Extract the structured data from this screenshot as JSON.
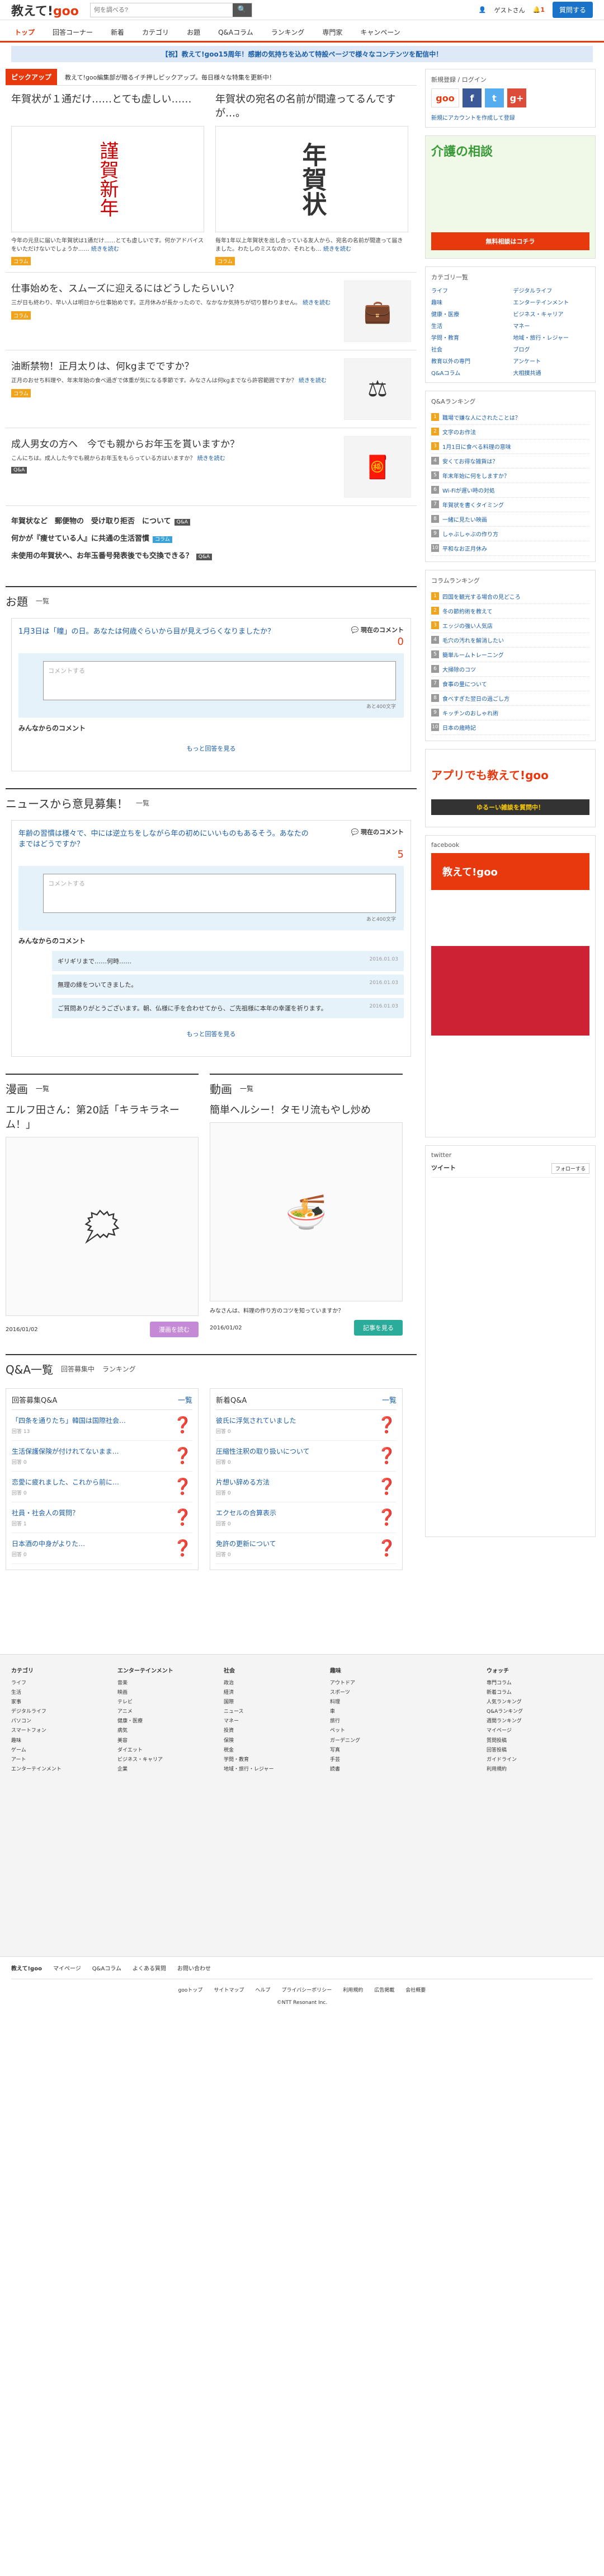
{
  "header": {
    "logo_main": "教えて!",
    "logo_sub": "goo",
    "search_placeholder": "何を調べる?",
    "guest": "ゲストさん",
    "notif": "1",
    "ask_button": "質問する"
  },
  "nav": [
    "トップ",
    "回答コーナー",
    "新着",
    "カテゴリ",
    "お題",
    "Q&Aコラム",
    "ランキング",
    "専門家",
    "キャンペーン"
  ],
  "banner": "【祝】教えて!goo15周年！感謝の気持ちを込めて特設ページで様々なコンテンツを配信中！",
  "pickup": {
    "label": "ピックアップ",
    "desc": "教えて!goo編集部が贈るイチ押しピックアップ。毎日様々な特集を更新中！",
    "cards": [
      {
        "title": "年賀状が１通だけ……とても虚しい……",
        "img": "謹賀新年",
        "desc": "今年の元旦に届いた年賀状は1通だけ……とても虚しいです。何かアドバイスをいただけないでしょうか……",
        "more": "続きを読む",
        "tag": "コラム"
      },
      {
        "title": "年賀状の宛名の名前が間違ってるんですが…。",
        "img": "年賀状",
        "desc": "毎年1年以上年賀状を出し合っている友人から、宛名の名前が間違って届きました。わたしのミスなのか、それとも…",
        "more": "続きを読む",
        "tag": "コラム"
      }
    ],
    "list": [
      {
        "title": "仕事始めを、スムーズに迎えるにはどうしたらいい？",
        "desc": "三が日も終わり、早い人は明日から仕事始めです。正月休みが長かったので、なかなか気持ちが切り替わりません。",
        "more": "続きを読む",
        "tag": "コラム",
        "icon": "💼"
      },
      {
        "title": "油断禁物！正月太りは、何kgまでですか？",
        "desc": "正月のおせち料理や、年末年始の食べ過ぎで体重が気になる季節です。みなさんは何kgまでなら許容範囲ですか？",
        "more": "続きを読む",
        "tag": "コラム",
        "icon": "⚖"
      },
      {
        "title": "成人男女の方へ　今でも親からお年玉を貰いますか？",
        "desc": "こんにちは。成人した今でも親からお年玉をもらっている方はいますか？",
        "more": "続きを読む",
        "tag": "Q&A",
        "icon": "🧧"
      }
    ],
    "links": [
      {
        "text": "年賀状など　郵便物の　受け取り拒否　について",
        "badge": "Q&A"
      },
      {
        "text": "何かが『痩せている人』に共通の生活習慣",
        "badge": "コラム"
      },
      {
        "text": "未使用の年賀状へ、お年玉番号発表後でも交換できる？",
        "badge": "Q&A"
      }
    ]
  },
  "odai": {
    "title": "お題",
    "more": "一覧",
    "question": "1月3日は「瞳」の日。あなたは何歳ぐらいから目が見えづらくなりましたか？",
    "count_label": "現在のコメント",
    "count": "0",
    "placeholder": "コメントする",
    "hint": "あと400文字",
    "comments": "みんなからのコメント",
    "more_link": "もっと回答を見る"
  },
  "news": {
    "title": "ニュースから意見募集！",
    "more": "一覧",
    "question": "年齢の習慣は様々で、中には逆立ちをしながら年の初めにいいものもあるそう。あなたのまではどうですか？",
    "count_label": "現在のコメント",
    "count": "5",
    "placeholder": "コメントする",
    "hint": "あと400文字",
    "comments": "みんなからのコメント",
    "items": [
      {
        "text": "ギリギリまで……何時……",
        "date": "2016.01.03"
      },
      {
        "text": "無理の縁をついてきました。",
        "date": "2016.01.03"
      },
      {
        "text": "ご質問ありがとうございます。朝、仏様に手を合わせてから、ご先祖様に本年の幸運を祈ります。",
        "date": "2016.01.03"
      }
    ],
    "more_link": "もっと回答を見る"
  },
  "manga": {
    "title": "漫画",
    "more": "一覧",
    "headline": "エルフ田さん：第20話「キラキラネーム！」",
    "date": "2016/01/02",
    "button": "漫画を読む"
  },
  "video": {
    "title": "動画",
    "more": "一覧",
    "headline": "簡単ヘルシー！タモリ流もやし炒め",
    "desc": "みなさんは、料理の作り方のコツを知っていますか？",
    "date": "2016/01/02",
    "button": "記事を見る"
  },
  "qa": {
    "title": "Q&A一覧",
    "tabs": [
      "回答募集中",
      "ランキング"
    ],
    "left": {
      "head": "回答募集Q&A",
      "more": "一覧",
      "items": [
        {
          "q": "「四条を通りたち」韓国は国際社会…",
          "meta": "回答 13"
        },
        {
          "q": "生活保護保険が付けれてないまま…",
          "meta": "回答 0"
        },
        {
          "q": "恋愛に疲れました、これから前に…",
          "meta": "回答 0"
        },
        {
          "q": "社員・社会人の質問？",
          "meta": "回答 1"
        },
        {
          "q": "日本酒の中身がよりた…",
          "meta": "回答 0"
        }
      ]
    },
    "right": {
      "head": "新着Q&A",
      "more": "一覧",
      "items": [
        {
          "q": "彼氏に浮気されていました",
          "meta": "回答 0"
        },
        {
          "q": "圧縮性注釈の取り扱いについて",
          "meta": "回答 0"
        },
        {
          "q": "片想い辞める方法",
          "meta": "回答 0"
        },
        {
          "q": "エクセルの合算表示",
          "meta": "回答 0"
        },
        {
          "q": "免許の更新について",
          "meta": "回答 0"
        }
      ]
    }
  },
  "side": {
    "login": "新規登録 / ログイン",
    "login_link": "新規にアカウントを作成して登録",
    "kaigo": "介護の相談",
    "kaigo_sub": "無料相談はコチラ",
    "cat_head": "カテゴリ一覧",
    "cats": [
      "ライフ",
      "デジタルライフ",
      "趣味",
      "エンターテインメント",
      "健康・医療",
      "ビジネス・キャリア",
      "生活",
      "マネー",
      "学問・教育",
      "地域・旅行・レジャー",
      "社会",
      "ブログ",
      "教育以外の専門",
      "アンケート",
      "Q&Aコラム",
      "大相撲共通"
    ],
    "rank_head": "Q&Aランキング",
    "ranks": [
      "職場で嫌な人にされたことは？",
      "文字のお作法",
      "1月1日に食べる料理の意味",
      "安くてお得な雑貨は？",
      "年末年始に何をしますか？",
      "Wi-Fiが遅い時の対処",
      "年賀状を書くタイミング",
      "一緒に見たい映画",
      "しゃぶしゃぶの作り方",
      "平和なお正月休み"
    ],
    "col_head": "コラムランキング",
    "cols": [
      "四国を観光する場合の見どころ",
      "冬の節約術を教えて",
      "エッジの強い人気店",
      "毛穴の汚れを解消したい",
      "簡単ルームトレーニング",
      "大掃除のコツ",
      "食事の量について",
      "食べすぎた翌日の過ごし方",
      "キッチンのおしゃれ術",
      "日本の歳時記"
    ],
    "app": "アプリでも教えて!goo",
    "app2": "ゆるーい雑談を質問中！",
    "fb": "facebook",
    "fb_name": "教えて!goo",
    "tw": "twitter",
    "tw_head": "ツイート",
    "tw_follow": "フォローする"
  },
  "footer": {
    "cols": [
      {
        "h": "カテゴリ",
        "items": [
          "ライフ",
          "生活",
          "家事",
          "デジタルライフ",
          "パソコン",
          "スマートフォン",
          "趣味",
          "ゲーム",
          "アート",
          "エンターテインメント"
        ]
      },
      {
        "h": "エンターテインメント",
        "items": [
          "音楽",
          "映画",
          "テレビ",
          "アニメ",
          "健康・医療",
          "病気",
          "美容",
          "ダイエット",
          "ビジネス・キャリア",
          "企業"
        ]
      },
      {
        "h": "社会",
        "items": [
          "政治",
          "経済",
          "国際",
          "ニュース",
          "マネー",
          "投資",
          "保険",
          "税金",
          "学問・教育",
          "地域・旅行・レジャー"
        ]
      },
      {
        "h": "趣味",
        "items": [
          "アウトドア",
          "スポーツ",
          "料理",
          "車",
          "旅行",
          "ペット",
          "ガーデニング",
          "写真",
          "手芸",
          "読書"
        ]
      },
      {
        "h": "ウォッチ",
        "items": [
          "専門コラム",
          "新着コラム",
          "人気ランキング",
          "Q&Aランキング",
          "週間ランキング",
          "マイページ",
          "質問投稿",
          "回答投稿",
          "ガイドライン",
          "利用規約"
        ]
      }
    ],
    "links": [
      "教えて!goo",
      "教えて!goo",
      "マイページ",
      "Q&Aコラム",
      "よくある質問",
      "お問い合わせ"
    ],
    "bottom": [
      "gooトップ",
      "サイトマップ",
      "ヘルプ",
      "プライバシーポリシー",
      "利用規約",
      "広告掲載",
      "会社概要"
    ],
    "copy": "©NTT Resonant Inc."
  },
  "colors": {
    "accent": "#e8380d",
    "link": "#1a5da8",
    "tag": "#f2a31c"
  }
}
